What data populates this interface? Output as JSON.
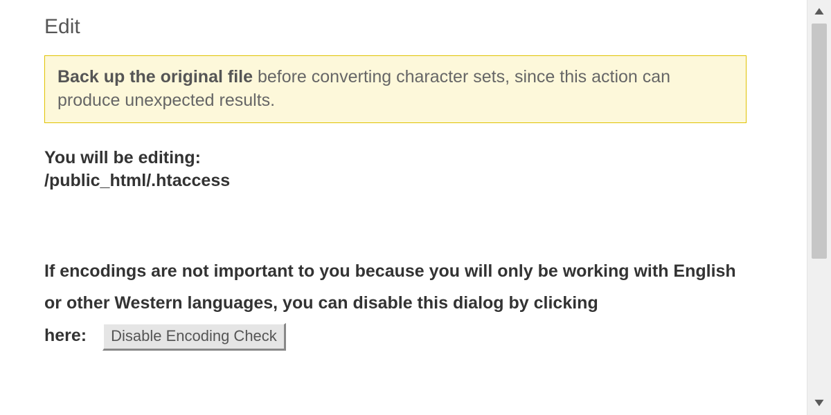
{
  "title": "Edit",
  "warning": {
    "bold": "Back up the original file",
    "rest": " before converting character sets, since this action can produce unexpected results."
  },
  "editing": {
    "label": "You will be editing:",
    "path": "/public_html/.htaccess"
  },
  "encoding": {
    "text_part1": "If encodings are not important to you because you will only be working with English or other Western languages, you can disable this dialog by clicking",
    "text_part2": "here:",
    "button_label": "Disable Encoding Check"
  },
  "scrollbar": {
    "up": "˄",
    "down": "˅"
  }
}
